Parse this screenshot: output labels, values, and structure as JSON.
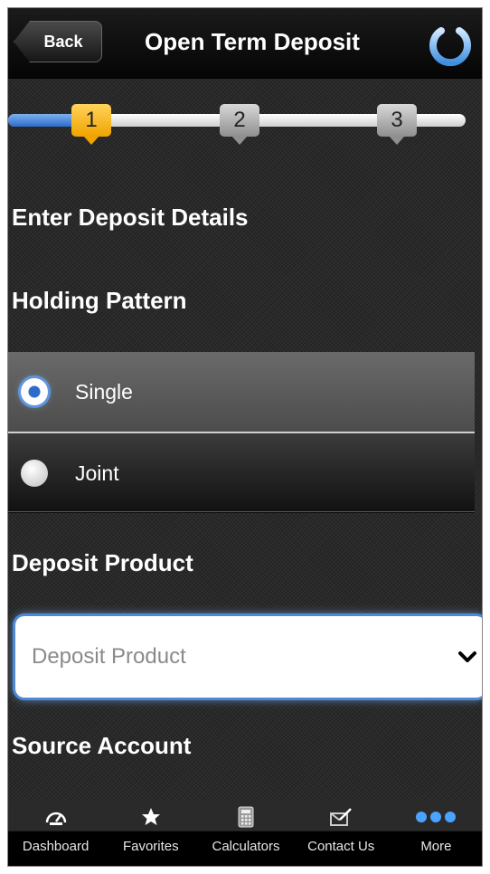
{
  "header": {
    "back_label": "Back",
    "title": "Open Term Deposit",
    "power_icon": "power-icon"
  },
  "stepper": {
    "steps": [
      "1",
      "2",
      "3"
    ],
    "current_step": 1,
    "progress": 0.15,
    "active_color": "#f0a400",
    "fill_color": "#2d6cc9"
  },
  "form": {
    "section_title": "Enter Deposit Details",
    "holding_pattern": {
      "label": "Holding Pattern",
      "options": [
        {
          "label": "Single",
          "selected": true
        },
        {
          "label": "Joint",
          "selected": false
        }
      ]
    },
    "deposit_product": {
      "label": "Deposit Product",
      "placeholder": "Deposit Product"
    },
    "source_account": {
      "label": "Source Account"
    }
  },
  "tabbar": {
    "items": [
      {
        "label": "Dashboard",
        "icon": "dashboard-gauge-icon"
      },
      {
        "label": "Favorites",
        "icon": "star-icon"
      },
      {
        "label": "Calculators",
        "icon": "calculator-icon"
      },
      {
        "label": "Contact Us",
        "icon": "contact-icon"
      },
      {
        "label": "More",
        "icon": "more-dots-icon"
      }
    ]
  }
}
